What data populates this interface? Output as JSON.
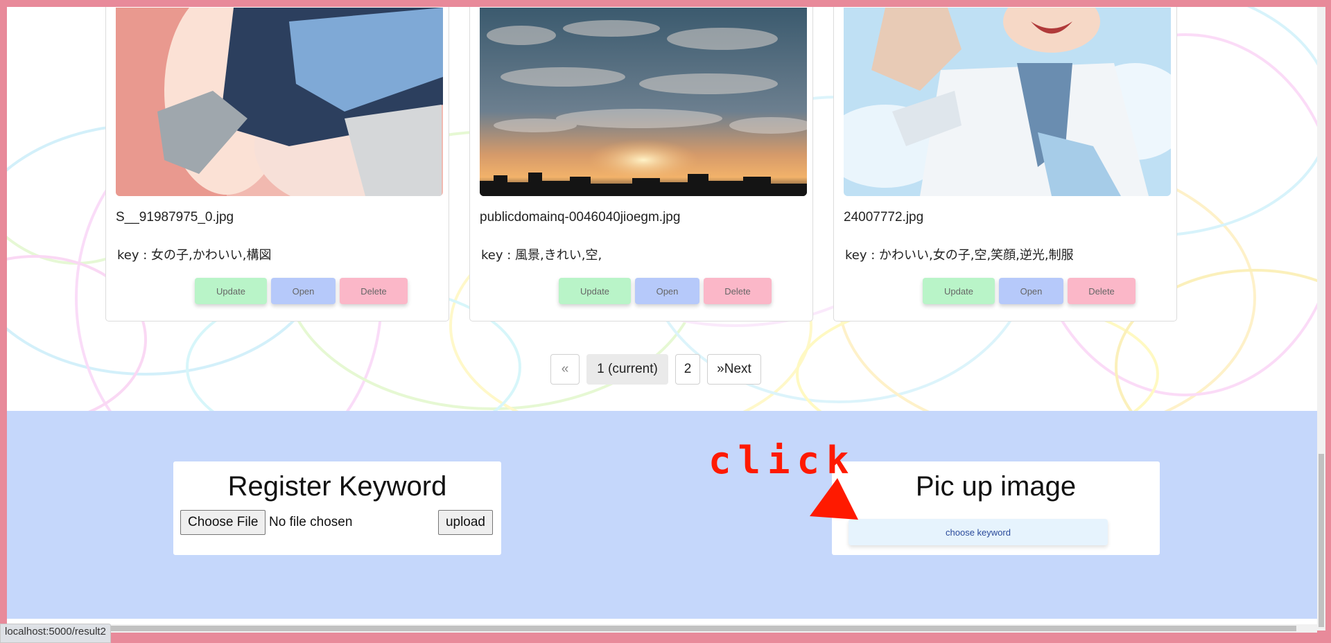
{
  "cards": [
    {
      "filename": "S__91987975_0.jpg",
      "keywords": "key : 女の子,かわいい,構図",
      "image_desc": "anime-illustration-legs",
      "buttons": {
        "update": "Update",
        "open": "Open",
        "delete": "Delete"
      }
    },
    {
      "filename": "publicdomainq-0046040jioegm.jpg",
      "keywords": "key : 風景,きれい,空,",
      "image_desc": "sunset-clouds-photo",
      "buttons": {
        "update": "Update",
        "open": "Open",
        "delete": "Delete"
      }
    },
    {
      "filename": "24007772.jpg",
      "keywords": "key : かわいい,女の子,空,笑顔,逆光,制服",
      "image_desc": "anime-girl-sailor-uniform",
      "buttons": {
        "update": "Update",
        "open": "Open",
        "delete": "Delete"
      }
    }
  ],
  "pagination": {
    "prev": "«",
    "current": "1 (current)",
    "page2": "2",
    "next": "»Next"
  },
  "register_panel": {
    "title": "Register Keyword",
    "choose_file": "Choose File",
    "file_status": "No file chosen",
    "upload": "upload"
  },
  "pickup_panel": {
    "title": "Pic up image",
    "choose_keyword": "choose keyword"
  },
  "annotation": {
    "text": "click",
    "color": "#ff1a00"
  },
  "status_bar": {
    "url": "localhost:5000/result2"
  },
  "colors": {
    "frame": "#e88a9a",
    "footer_bg": "#c5d7fb",
    "update_btn": "#b9f4c8",
    "open_btn": "#b6c9fa",
    "delete_btn": "#fbb7c8",
    "choose_keyword_btn": "#e6f3fd"
  }
}
